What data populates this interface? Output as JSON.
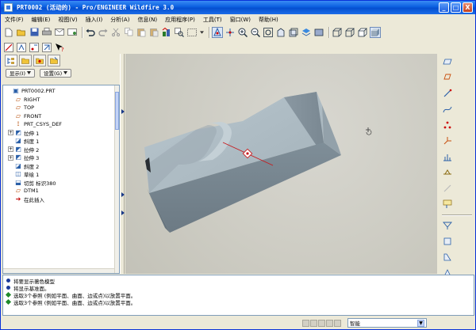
{
  "window": {
    "title": "PRT0002 (活动的) - Pro/ENGINEER Wildfire 3.0",
    "minimize": "_",
    "maximize": "□",
    "close": "X"
  },
  "menu": [
    {
      "label": "文件(F)"
    },
    {
      "label": "编辑(E)"
    },
    {
      "label": "视图(V)"
    },
    {
      "label": "插入(I)"
    },
    {
      "label": "分析(A)"
    },
    {
      "label": "信息(N)"
    },
    {
      "label": "应用程序(P)"
    },
    {
      "label": "工具(T)"
    },
    {
      "label": "窗口(W)"
    },
    {
      "label": "帮助(H)"
    }
  ],
  "left": {
    "show_label": "显示(I)",
    "settings_label": "设置(G)"
  },
  "tree": [
    {
      "text": "PRT0002.PRT",
      "icon": "part-icon",
      "color": "#2a5fa8",
      "indent": 0,
      "expand": ""
    },
    {
      "text": "RIGHT",
      "icon": "datum-plane-icon",
      "color": "#b8500e",
      "indent": 1,
      "expand": ""
    },
    {
      "text": "TOP",
      "icon": "datum-plane-icon",
      "color": "#b8500e",
      "indent": 1,
      "expand": ""
    },
    {
      "text": "FRONT",
      "icon": "datum-plane-icon",
      "color": "#b8500e",
      "indent": 1,
      "expand": ""
    },
    {
      "text": "PRT_CSYS_DEF",
      "icon": "csys-icon",
      "color": "#b8500e",
      "indent": 1,
      "expand": ""
    },
    {
      "text": "拉伸 1",
      "icon": "extrude-icon",
      "color": "#2a5fa8",
      "indent": 1,
      "expand": "+"
    },
    {
      "text": "斜度 1",
      "icon": "draft-icon",
      "color": "#2a5fa8",
      "indent": 1,
      "expand": ""
    },
    {
      "text": "拉伸 2",
      "icon": "extrude-icon",
      "color": "#2a5fa8",
      "indent": 1,
      "expand": "+"
    },
    {
      "text": "拉伸 3",
      "icon": "extrude-icon",
      "color": "#2a5fa8",
      "indent": 1,
      "expand": "+"
    },
    {
      "text": "斜度 2",
      "icon": "draft-icon",
      "color": "#2a5fa8",
      "indent": 1,
      "expand": ""
    },
    {
      "text": "草绘 1",
      "icon": "sketch-icon",
      "color": "#2a5fa8",
      "indent": 1,
      "expand": ""
    },
    {
      "text": "切剪 标识380",
      "icon": "cut-icon",
      "color": "#2a5fa8",
      "indent": 1,
      "expand": ""
    },
    {
      "text": "DTM1",
      "icon": "datum-plane-icon",
      "color": "#b8500e",
      "indent": 1,
      "expand": ""
    },
    {
      "text": "在此插入",
      "icon": "insert-here-icon",
      "color": "#c00000",
      "indent": 1,
      "expand": ""
    }
  ],
  "messages": [
    {
      "text": "将要显示著色模型",
      "icon": "info-icon",
      "color": "#1a3a9a"
    },
    {
      "text": "将显示基准面。",
      "icon": "info-icon",
      "color": "#1a3a9a"
    },
    {
      "text": "选取3个参照 (例如平面、曲面、边或点)以放置平面。",
      "icon": "prompt-icon",
      "color": "#1f8a2a"
    },
    {
      "text": "选取3个参照 (例如平面、曲面、边或点)以放置平面。",
      "icon": "prompt-icon",
      "color": "#1f8a2a"
    }
  ],
  "status": {
    "filter_value": "智能"
  }
}
